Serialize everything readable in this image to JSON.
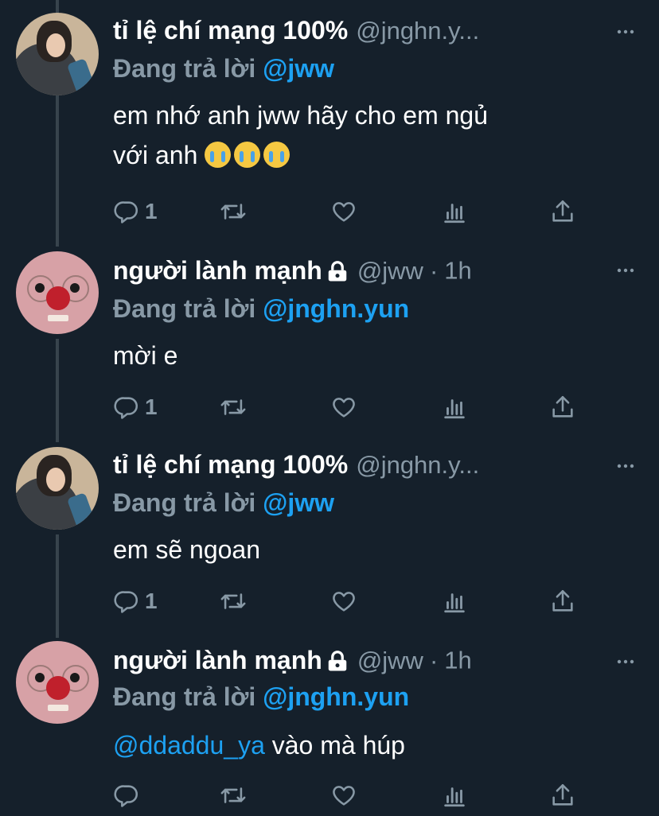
{
  "tweets": [
    {
      "author_name": "tỉ lệ chí mạng 100%",
      "handle": "@jnghn.y...",
      "replying_label": "Đang trả lời ",
      "replying_to": "@jww",
      "text_line1": "em nhớ anh jww hãy cho em ngủ",
      "text_line2": "với anh",
      "emoji": "loudly-crying-face x3",
      "reply_count": "1"
    },
    {
      "author_name": "người lành mạnh",
      "handle": "@jww",
      "separator": "·",
      "time": "1h",
      "replying_label": "Đang trả lời ",
      "replying_to": "@jnghn.yun",
      "text": "mời e",
      "reply_count": "1"
    },
    {
      "author_name": "tỉ lệ chí mạng 100%",
      "handle": "@jnghn.y...",
      "replying_label": "Đang trả lời ",
      "replying_to": "@jww",
      "text": "em sẽ ngoan",
      "reply_count": "1"
    },
    {
      "author_name": "người lành mạnh",
      "handle": "@jww",
      "separator": "·",
      "time": "1h",
      "replying_label": "Đang trả lời ",
      "replying_to": "@jnghn.yun",
      "text_mention": "@ddaddu_ya",
      "text": " vào mà húp",
      "reply_count": ""
    }
  ],
  "icons": {
    "actions": [
      "reply-icon",
      "retweet-icon",
      "like-icon",
      "analytics-icon",
      "share-icon"
    ],
    "header": [
      "more-icon",
      "lock-icon"
    ]
  },
  "colors": {
    "background": "#15202b",
    "accent": "#1da1f2",
    "secondary_text": "#8899a6",
    "thread_line": "#38444d"
  }
}
